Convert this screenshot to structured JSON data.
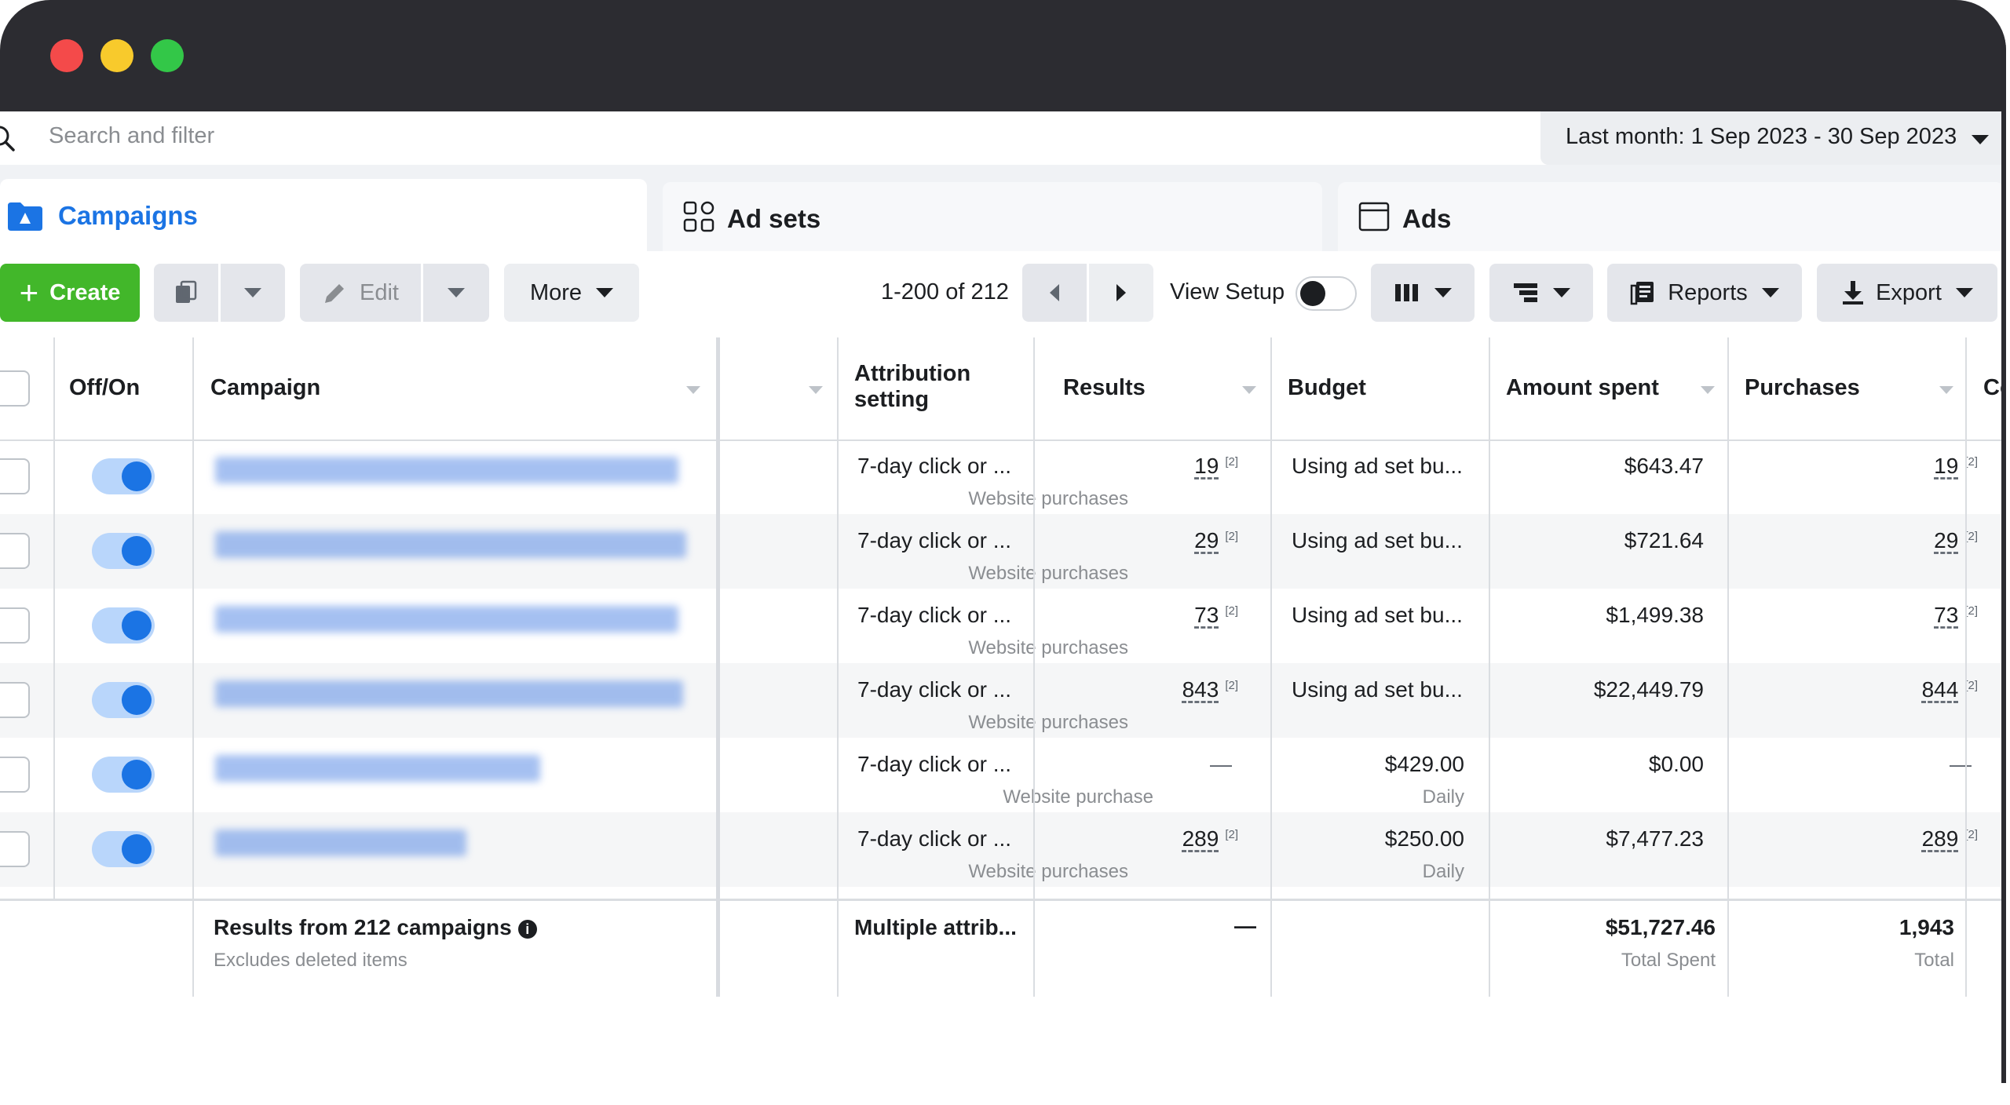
{
  "window": {
    "colors": {
      "titlebar": "#2c2c31",
      "close": "#f44a4a",
      "minimize": "#f8ca2c",
      "maximize": "#33c748"
    }
  },
  "search": {
    "placeholder": "Search and filter"
  },
  "date_range": {
    "label": "Last month: 1 Sep 2023 - 30 Sep 2023"
  },
  "tabs": [
    {
      "label": "Campaigns",
      "active": true,
      "icon": "campaign-folder-icon"
    },
    {
      "label": "Ad sets",
      "active": false,
      "icon": "grid-icon"
    },
    {
      "label": "Ads",
      "active": false,
      "icon": "ad-window-icon"
    }
  ],
  "toolbar": {
    "create_label": "Create",
    "edit_label": "Edit",
    "more_label": "More",
    "pagination": "1-200 of 212",
    "view_setup_label": "View Setup",
    "reports_label": "Reports",
    "export_label": "Export"
  },
  "columns": {
    "off_on": "Off/On",
    "campaign": "Campaign",
    "attribution_line1": "Attribution",
    "attribution_line2": "setting",
    "results": "Results",
    "budget": "Budget",
    "amount_spent": "Amount spent",
    "purchases": "Purchases",
    "next_partial": "Co"
  },
  "rows": [
    {
      "attribution": "7-day click or ...",
      "results": "19",
      "results_sup": "[2]",
      "results_sub": "Website purchases",
      "budget": "Using ad set bu...",
      "budget_sub": "",
      "spent": "$643.47",
      "purchases": "19",
      "purchases_sup": "[2]"
    },
    {
      "attribution": "7-day click or ...",
      "results": "29",
      "results_sup": "[2]",
      "results_sub": "Website purchases",
      "budget": "Using ad set bu...",
      "budget_sub": "",
      "spent": "$721.64",
      "purchases": "29",
      "purchases_sup": "[2]"
    },
    {
      "attribution": "7-day click or ...",
      "results": "73",
      "results_sup": "[2]",
      "results_sub": "Website purchases",
      "budget": "Using ad set bu...",
      "budget_sub": "",
      "spent": "$1,499.38",
      "purchases": "73",
      "purchases_sup": "[2]"
    },
    {
      "attribution": "7-day click or ...",
      "results": "843",
      "results_sup": "[2]",
      "results_sub": "Website purchases",
      "budget": "Using ad set bu...",
      "budget_sub": "",
      "spent": "$22,449.79",
      "purchases": "844",
      "purchases_sup": "[2]"
    },
    {
      "attribution": "7-day click or ...",
      "results": "—",
      "results_sup": "",
      "results_sub": "Website purchase",
      "budget": "$429.00",
      "budget_sub": "Daily",
      "spent": "$0.00",
      "purchases": "—",
      "purchases_sup": ""
    },
    {
      "attribution": "7-day click or ...",
      "results": "289",
      "results_sup": "[2]",
      "results_sub": "Website purchases",
      "budget": "$250.00",
      "budget_sub": "Daily",
      "spent": "$7,477.23",
      "purchases": "289",
      "purchases_sup": "[2]"
    }
  ],
  "totals": {
    "title": "Results from 212 campaigns",
    "subtitle": "Excludes deleted items",
    "attribution": "Multiple attrib...",
    "results": "—",
    "spent": "$51,727.46",
    "spent_sub": "Total Spent",
    "purchases": "1,943",
    "purchases_sub": "Total"
  }
}
